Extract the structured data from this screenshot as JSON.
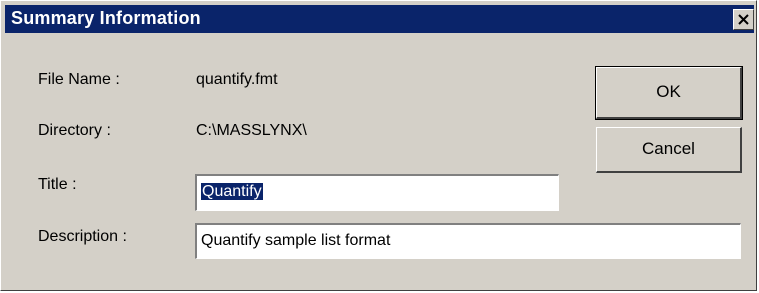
{
  "window": {
    "title": "Summary Information"
  },
  "fields": {
    "file_name_label": "File Name :",
    "file_name_value": "quantify.fmt",
    "directory_label": "Directory :",
    "directory_value": "C:\\MASSLYNX\\",
    "title_label": "Title :",
    "title_value": "Quantify",
    "description_label": "Description :",
    "description_value": "Quantify sample list format"
  },
  "buttons": {
    "ok_label": "OK",
    "cancel_label": "Cancel"
  },
  "colors": {
    "title_bar": "#0a246a",
    "dialog_face": "#d4d0c8",
    "selection": "#0a246a"
  },
  "icons": {
    "close": "close-icon"
  }
}
